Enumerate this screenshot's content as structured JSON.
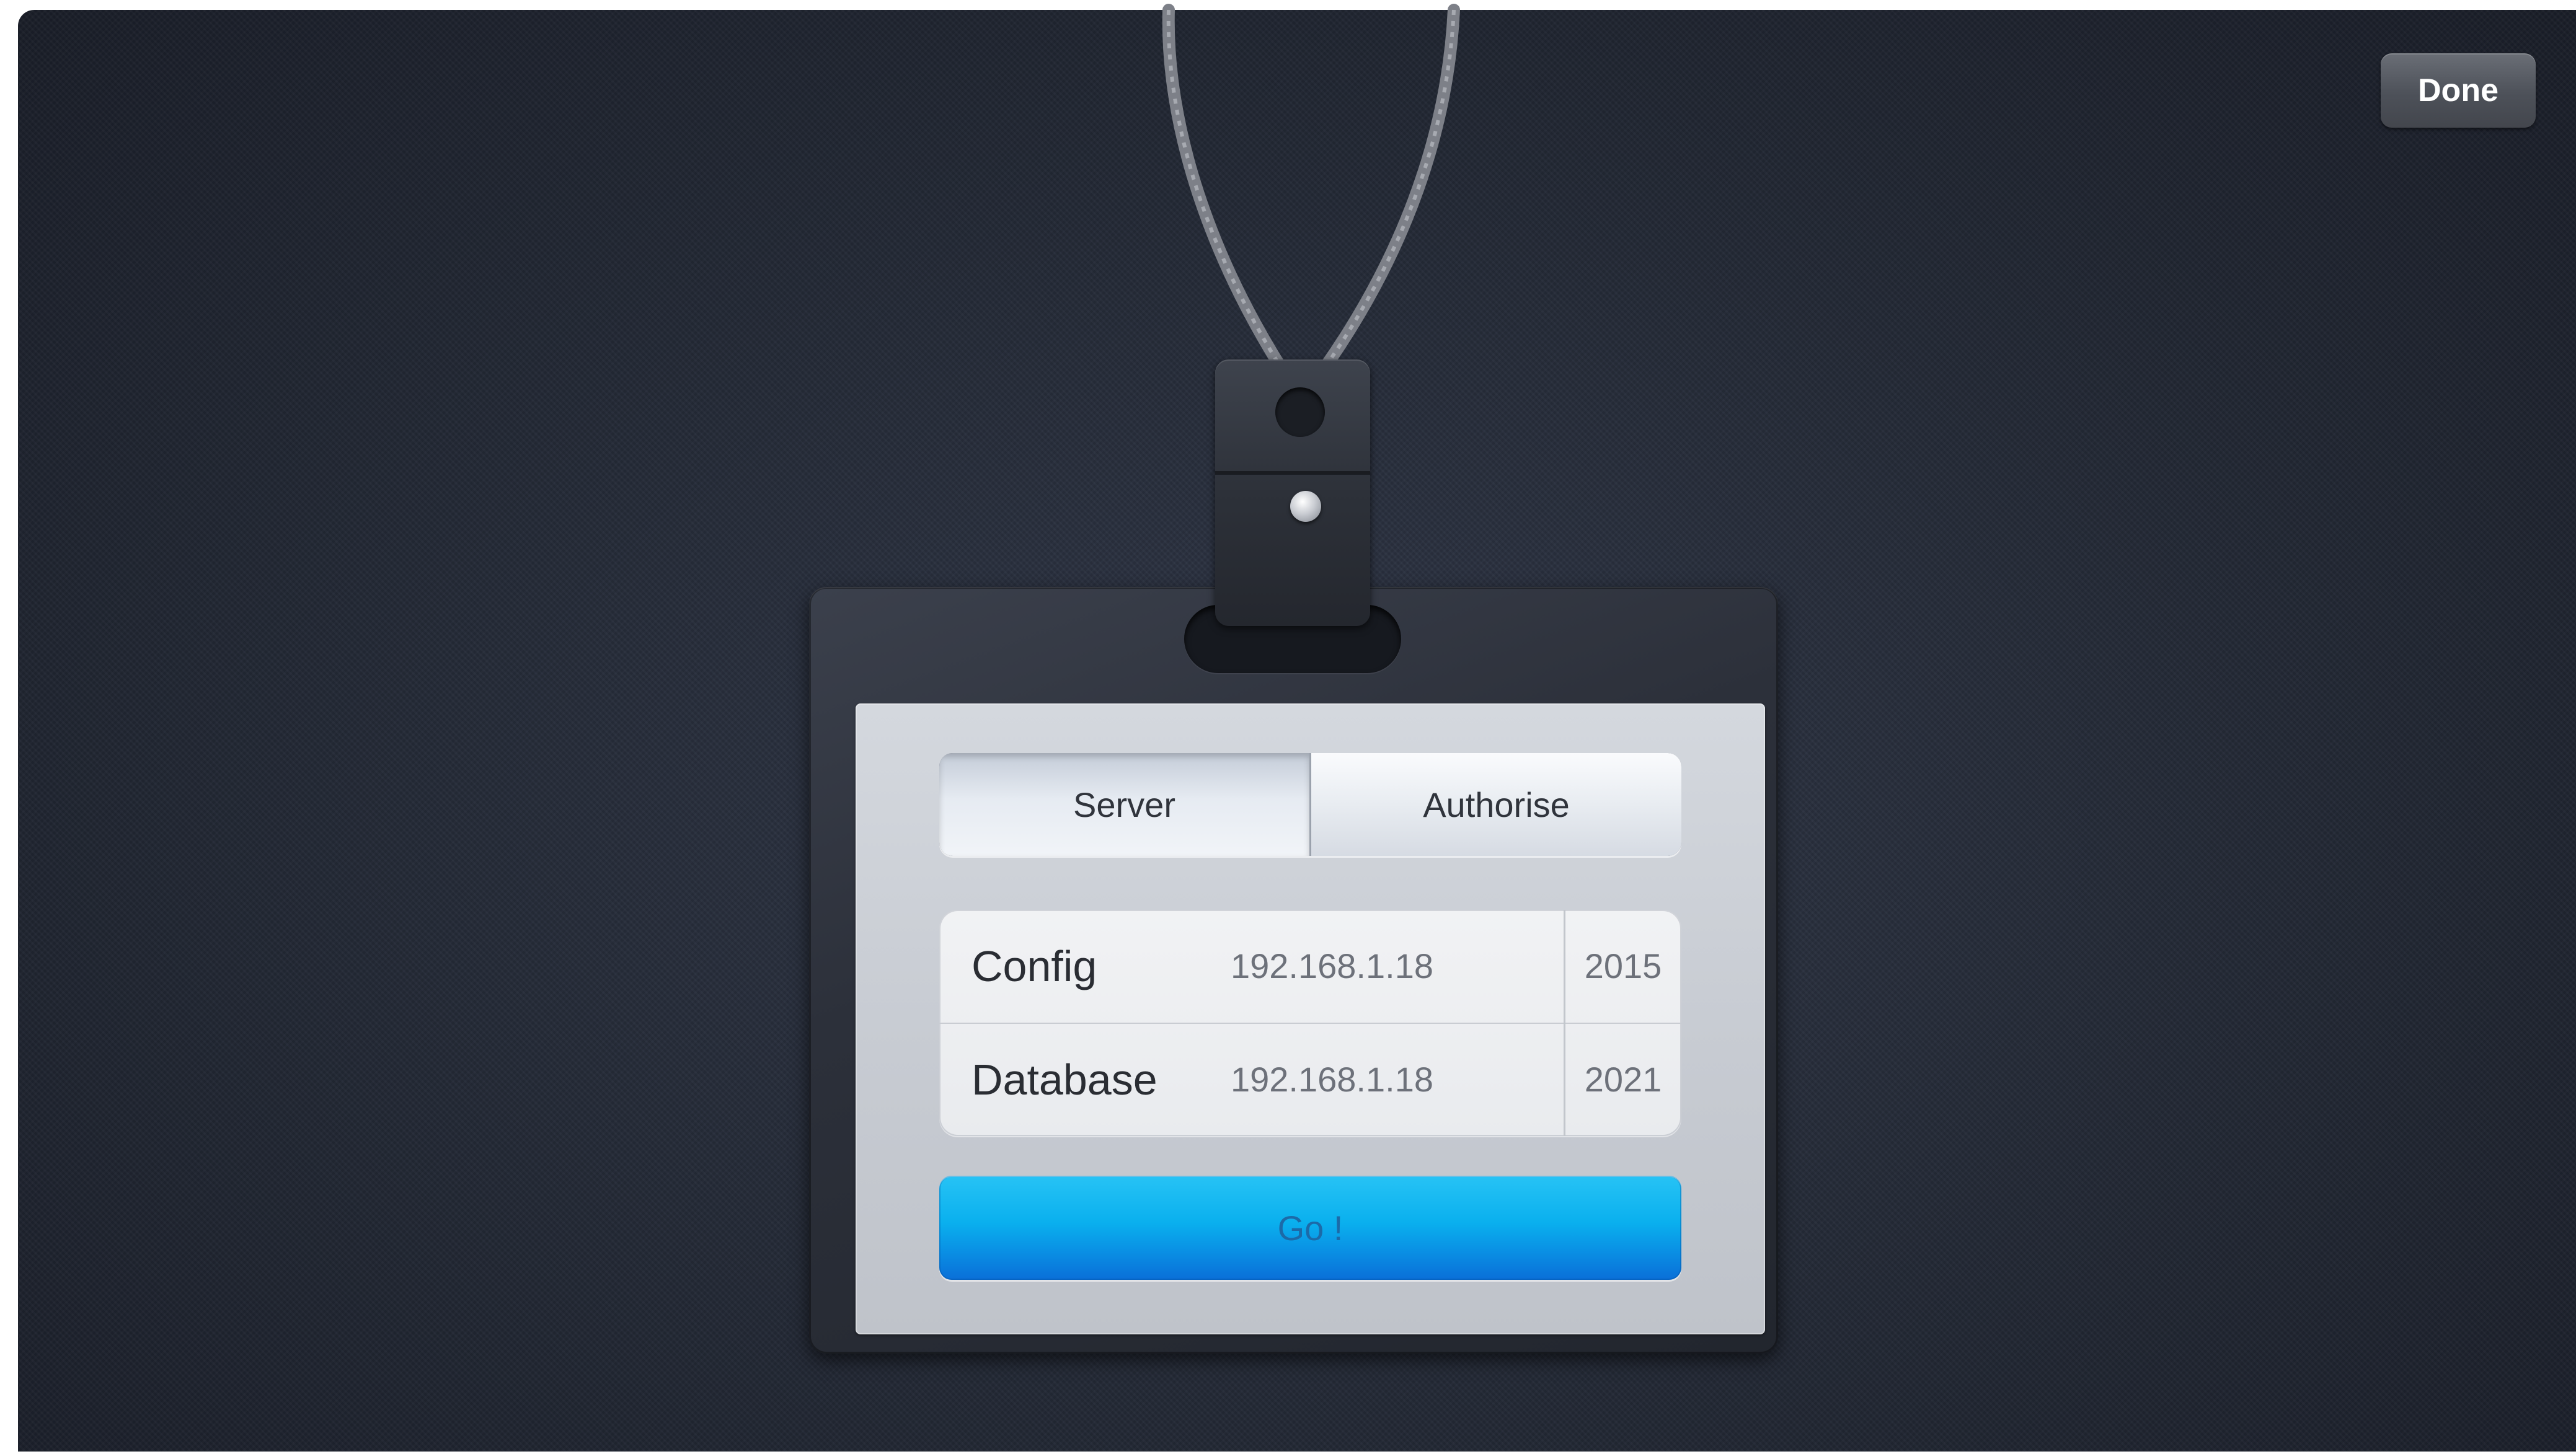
{
  "toolbar": {
    "done_label": "Done"
  },
  "badge": {
    "tabs": [
      {
        "label": "Server",
        "selected": true
      },
      {
        "label": "Authorise",
        "selected": false
      }
    ],
    "rows": [
      {
        "label": "Config",
        "host": "192.168.1.18",
        "port": "2015"
      },
      {
        "label": "Database",
        "host": "192.168.1.18",
        "port": "2021"
      }
    ],
    "go_label": "Go !"
  },
  "icons": {
    "clip_rivet": "rivet-icon",
    "clip_hole": "hole-icon"
  },
  "colors": {
    "go_button": "#0a9be8",
    "background": "#252b38",
    "done_button": "#55585f"
  }
}
